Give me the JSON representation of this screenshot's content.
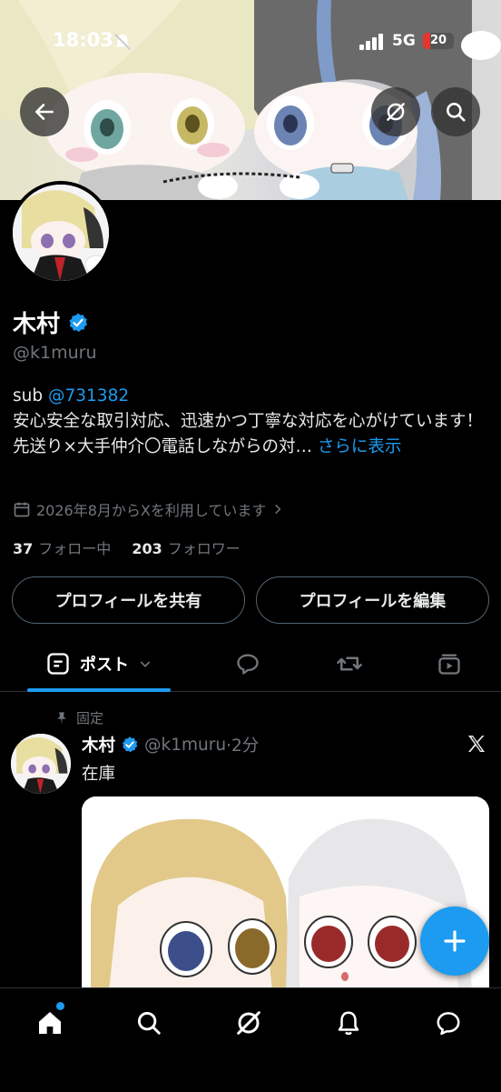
{
  "status_bar": {
    "time": "18:03",
    "network": "5G",
    "battery": "20"
  },
  "profile": {
    "name": "木村",
    "handle": "@k1muru",
    "bio_prefix": "sub ",
    "bio_link": "@731382",
    "bio_line1": "安心安全な取引対応、迅速かつ丁寧な対応を心がけています！",
    "bio_line2": "先送り×大手仲介〇電話しながらの対…",
    "show_more": " さらに表示",
    "joined": "2026年8月からXを利用しています",
    "following_count": "37",
    "following_label": "フォロー中",
    "followers_count": "203",
    "followers_label": "フォロワー"
  },
  "buttons": {
    "share": "プロフィールを共有",
    "edit": "プロフィールを編集"
  },
  "tabs": {
    "posts": "ポスト"
  },
  "pinned_post": {
    "pinned_label": "固定",
    "name": "木村",
    "handle": "@k1muru",
    "time": "·2分",
    "text": "在庫"
  },
  "colors": {
    "accent": "#1d9bf0",
    "background": "#000000",
    "secondary_text": "#71767b"
  }
}
